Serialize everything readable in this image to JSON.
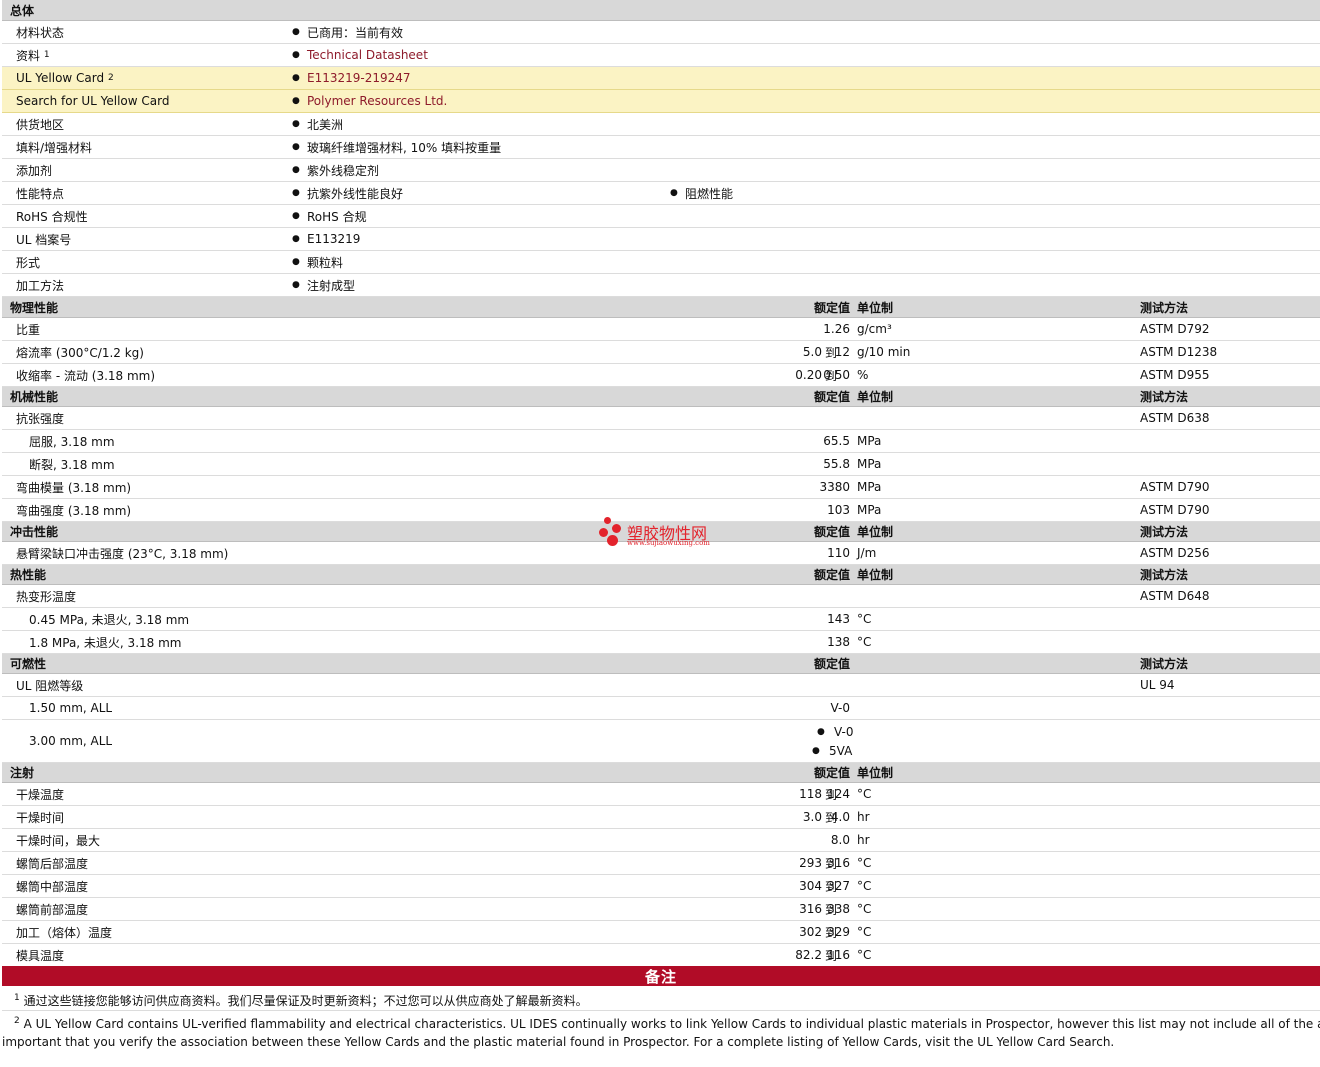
{
  "general": {
    "header": "总体",
    "material_status": {
      "label": "材料状态",
      "value": "已商用：当前有效"
    },
    "literature": {
      "label": "资料",
      "sup": "1",
      "value": "Technical Datasheet"
    },
    "ul_yellow_card": {
      "label": "UL Yellow Card",
      "sup": "2",
      "value": "E113219-219247"
    },
    "search_ul": {
      "label": "Search for UL Yellow Card",
      "value": "Polymer Resources Ltd."
    },
    "availability": {
      "label": "供货地区",
      "value": "北美洲"
    },
    "filler": {
      "label": "填料/增强材料",
      "value": "玻璃纤维增强材料, 10% 填料按重量"
    },
    "additive": {
      "label": "添加剂",
      "value": "紫外线稳定剂"
    },
    "features": {
      "label": "性能特点",
      "value1": "抗紫外线性能良好",
      "value2": "阻燃性能"
    },
    "rohs": {
      "label": "RoHS 合规性",
      "value": "RoHS 合规"
    },
    "ul_file": {
      "label": "UL 档案号",
      "value": "E113219"
    },
    "form": {
      "label": "形式",
      "value": "颗粒料"
    },
    "processing": {
      "label": "加工方法",
      "value": "注射成型"
    }
  },
  "col": {
    "nominal": "额定值",
    "unit": "单位制",
    "method": "测试方法",
    "to": "到"
  },
  "physical": {
    "header": "物理性能",
    "sg": {
      "label": "比重",
      "value": "1.26",
      "unit": "g/cm³",
      "method": "ASTM D792"
    },
    "mfr": {
      "label": "熔流率  (300°C/1.2 kg)",
      "lo": "5.0",
      "hi": "12",
      "unit": "g/10 min",
      "method": "ASTM D1238"
    },
    "shrink": {
      "label": "收缩率  - 流动  (3.18 mm)",
      "lo": "0.20",
      "hi": "0.50",
      "unit": "%",
      "method": "ASTM D955"
    }
  },
  "mechanical": {
    "header": "机械性能",
    "tensile": {
      "label": "抗张强度",
      "method": "ASTM D638"
    },
    "yield": {
      "label": "屈服, 3.18 mm",
      "value": "65.5",
      "unit": "MPa"
    },
    "break": {
      "label": "断裂, 3.18 mm",
      "value": "55.8",
      "unit": "MPa"
    },
    "flex_mod": {
      "label": "弯曲模量  (3.18 mm)",
      "value": "3380",
      "unit": "MPa",
      "method": "ASTM D790"
    },
    "flex_str": {
      "label": "弯曲强度  (3.18 mm)",
      "value": "103",
      "unit": "MPa",
      "method": "ASTM D790"
    }
  },
  "impact": {
    "header": "冲击性能",
    "izod": {
      "label": "悬臂梁缺口冲击强度  (23°C, 3.18 mm)",
      "value": "110",
      "unit": "J/m",
      "method": "ASTM D256"
    }
  },
  "thermal": {
    "header": "热性能",
    "dtul": {
      "label": "热变形温度",
      "method": "ASTM D648"
    },
    "dtul1": {
      "label": "0.45 MPa, 未退火, 3.18 mm",
      "value": "143",
      "unit": "°C"
    },
    "dtul2": {
      "label": "1.8 MPa, 未退火, 3.18 mm",
      "value": "138",
      "unit": "°C"
    }
  },
  "flammability": {
    "header": "可燃性",
    "ul94": {
      "label": "UL 阻燃等级",
      "method": "UL 94"
    },
    "r1": {
      "label": "1.50 mm, ALL",
      "value": "V-0"
    },
    "r2": {
      "label": "3.00 mm, ALL",
      "value1": "V-0",
      "value2": "5VA"
    }
  },
  "injection": {
    "header": "注射",
    "rows": [
      {
        "label": "干燥温度",
        "lo": "118",
        "hi": "124",
        "unit": "°C"
      },
      {
        "label": "干燥时间",
        "lo": "3.0",
        "hi": "4.0",
        "unit": "hr"
      },
      {
        "label": "干燥时间，最大",
        "value": "8.0",
        "unit": "hr"
      },
      {
        "label": "螺筒后部温度",
        "lo": "293",
        "hi": "316",
        "unit": "°C"
      },
      {
        "label": "螺筒中部温度",
        "lo": "304",
        "hi": "327",
        "unit": "°C"
      },
      {
        "label": "螺筒前部温度",
        "lo": "316",
        "hi": "338",
        "unit": "°C"
      },
      {
        "label": "加工（熔体）温度",
        "lo": "302",
        "hi": "329",
        "unit": "°C"
      },
      {
        "label": "模具温度",
        "lo": "82.2",
        "hi": "116",
        "unit": "°C"
      }
    ]
  },
  "notes": {
    "header": "备注",
    "n1_sup": "1",
    "n1": "通过这些链接您能够访问供应商资料。我们尽量保证及时更新资料；不过您可以从供应商处了解最新资料。",
    "n2_sup": "2",
    "n2_line1": "A UL Yellow Card contains UL-verified flammability and electrical characteristics. UL IDES continually works to link Yellow Cards to individual plastic materials in Prospector, however this list may not include all of the appropriate Yellow Cards. It is",
    "n2_line2": "important that you verify the association between these Yellow Cards and the plastic material found in Prospector. For a complete listing of Yellow Cards, visit the UL Yellow Card Search."
  },
  "watermark": {
    "name": "塑胶物性网",
    "url": "www.sujiaowuxing.com",
    "color": "#e3232c"
  }
}
